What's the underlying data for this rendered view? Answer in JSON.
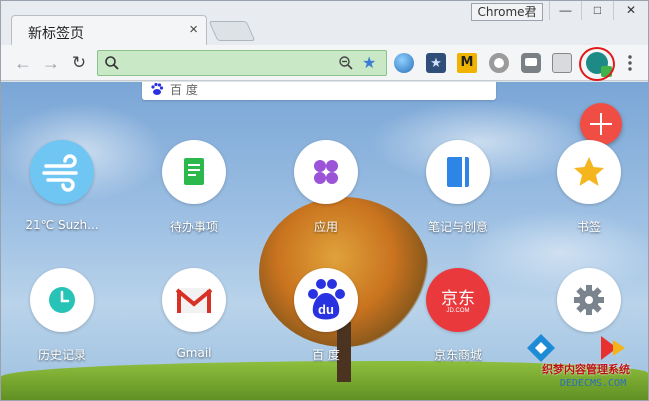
{
  "window": {
    "tab_title": "新标签页",
    "tab_close": "×",
    "profile_name": "Chrome君",
    "min_glyph": "—",
    "max_glyph": "□",
    "close_glyph": "✕"
  },
  "toolbar": {
    "back_glyph": "←",
    "forward_glyph": "→",
    "reload_glyph": "↻",
    "address_value": "",
    "star_glyph": "★",
    "extensions": [
      "globe-extension-icon",
      "bookmark-star-extension-icon",
      "m-extension-icon",
      "circle-extension-icon",
      "box-extension-icon",
      "plug-extension-icon",
      "profile-extension-icon"
    ],
    "m_label": "M",
    "menu_glyph": "⋮"
  },
  "newtab": {
    "search_placeholder": "百 度",
    "add_glyph": "+",
    "tiles_row1": [
      {
        "label": "21℃ Suzh...",
        "icon": "weather-wind-icon",
        "bg": "#6fc6f3"
      },
      {
        "label": "待办事项",
        "icon": "todo-icon",
        "bg": "#ffffff"
      },
      {
        "label": "应用",
        "icon": "apps-icon",
        "bg": "#ffffff"
      },
      {
        "label": "笔记与创意",
        "icon": "notes-icon",
        "bg": "#ffffff"
      },
      {
        "label": "书签",
        "icon": "bookmark-star-icon",
        "bg": "#ffffff"
      }
    ],
    "tiles_row2": [
      {
        "label": "历史记录",
        "icon": "history-clock-icon",
        "bg": "#ffffff"
      },
      {
        "label": "Gmail",
        "icon": "gmail-icon",
        "bg": "#ffffff"
      },
      {
        "label": "百 度",
        "icon": "baidu-icon",
        "bg": "#2932e1"
      },
      {
        "label": "京东商城",
        "icon": "jd-icon",
        "bg": "#e9393d"
      },
      {
        "label": "",
        "icon": "settings-gear-icon",
        "bg": "#ffffff"
      }
    ],
    "jd_text": "京东",
    "jd_sub": "JD.COM",
    "baidu_text": "du"
  },
  "watermark": {
    "title": "织梦内容管理系统",
    "url": "DEDECMS.COM"
  },
  "colors": {
    "accent_green": "#c9e8c6",
    "fab_red": "#f04e45",
    "highlight_ring": "#e01a1a"
  }
}
